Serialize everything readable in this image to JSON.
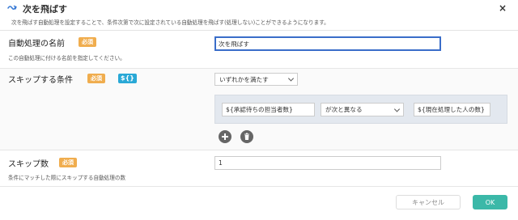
{
  "dialog": {
    "title": "次を飛ばす",
    "subtitle": "次を飛ばす自動処理を設定することで、条件次第で次に設定されている自動処理を飛ばす(処理しない)ことができるようになります。",
    "close_label": "×"
  },
  "name_row": {
    "label": "自動処理の名前",
    "required_badge": "必須",
    "hint": "この自動処理に付ける名前を指定してください。",
    "value": "次を飛ばす"
  },
  "condition_row": {
    "label": "スキップする条件",
    "required_badge": "必須",
    "variable_badge": "${}",
    "match_mode": "いずれかを満たす",
    "condition": {
      "left": "${承認待ちの担当者数}",
      "operator": "が次と異なる",
      "right": "${現在処理した人の数}"
    }
  },
  "skip_row": {
    "label": "スキップ数",
    "required_badge": "必須",
    "hint": "条件にマッチした際にスキップする自動処理の数",
    "value": "1"
  },
  "footer": {
    "cancel_label": "キャンセル",
    "ok_label": "OK"
  },
  "colors": {
    "required": "#f0ad4e",
    "variable": "#29a8d6",
    "ok": "#3bb8a8",
    "focus": "#3a6dc9"
  },
  "icons": [
    "skip-arrow-icon",
    "close-icon",
    "chevron-down-icon",
    "plus-icon",
    "trash-icon"
  ]
}
